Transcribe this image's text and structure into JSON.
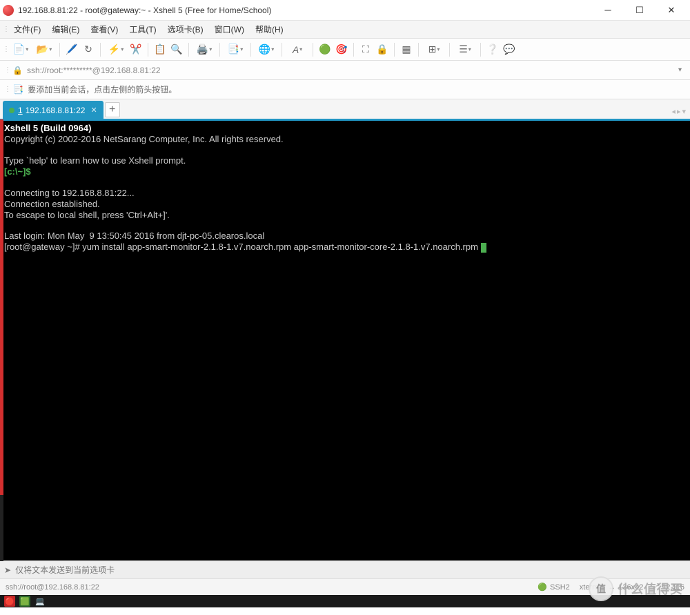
{
  "title_bar": {
    "title": "192.168.8.81:22 - root@gateway:~ - Xshell 5 (Free for Home/School)"
  },
  "menu": {
    "items": [
      "文件(F)",
      "编辑(E)",
      "查看(V)",
      "工具(T)",
      "选项卡(B)",
      "窗口(W)",
      "帮助(H)"
    ]
  },
  "address": {
    "text": "ssh://root:*********@192.168.8.81:22"
  },
  "info": {
    "text": "要添加当前会话，点击左侧的箭头按钮。"
  },
  "tab": {
    "index": "1",
    "label": "192.168.8.81:22"
  },
  "terminal": {
    "line_header": "Xshell 5 (Build 0964)",
    "line_copyright": "Copyright (c) 2002-2016 NetSarang Computer, Inc. All rights reserved.",
    "line_help": "Type `help' to learn how to use Xshell prompt.",
    "prompt_local": "[c:\\~]$",
    "line_conn1": "Connecting to 192.168.8.81:22...",
    "line_conn2": "Connection established.",
    "line_conn3": "To escape to local shell, press 'Ctrl+Alt+]'.",
    "line_last": "Last login: Mon May  9 13:50:45 2016 from djt-pc-05.clearos.local",
    "prompt_remote": "[root@gateway ~]# ",
    "command": "yum install app-smart-monitor-2.1.8-1.v7.noarch.rpm app-smart-monitor-core-2.1.8-1.v7.noarch.rpm "
  },
  "input_bar": {
    "placeholder": "仅将文本发送到当前选项卡"
  },
  "status": {
    "left": "ssh://root@192.168.8.81:22",
    "ssh": "SSH2",
    "term": "xterm",
    "size": "136x42",
    "pos": "12,116"
  },
  "watermark": {
    "char": "值",
    "text": "什么值得买"
  },
  "toolbar_icons": [
    "new-session-icon",
    "open-icon",
    "properties-icon",
    "reconnect-icon",
    "disconnect-icon",
    "copy-icon",
    "paste-icon",
    "find-icon",
    "print-icon",
    "log-icon",
    "encoding-icon",
    "font-icon",
    "color-icon",
    "transparency-icon",
    "fullscreen-icon",
    "lock-icon",
    "always-on-top-icon",
    "tile-icon",
    "options-icon",
    "help-icon",
    "compose-icon"
  ]
}
